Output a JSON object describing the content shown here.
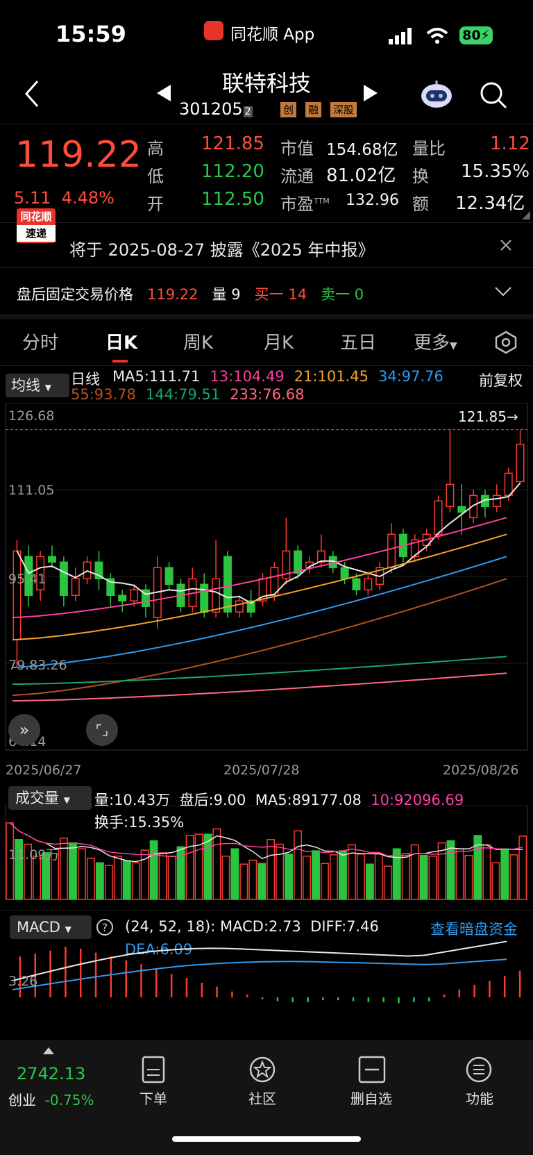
{
  "status": {
    "time": "15:59",
    "app": "同花顺 App",
    "battery": "80"
  },
  "header": {
    "title": "联特科技",
    "code": "301205",
    "code_suffix": "2",
    "tags": [
      "创",
      "融",
      "深股"
    ]
  },
  "quote": {
    "price": "119.22",
    "change": "5.11",
    "change_pct": "4.48%",
    "high_label": "高",
    "high": "121.85",
    "low_label": "低",
    "low": "112.20",
    "open_label": "开",
    "open": "112.50",
    "mcap_label": "市值",
    "mcap": "154.68亿",
    "float_label": "流通",
    "float": "81.02亿",
    "pe_label": "市盈",
    "pe_sup": "TTM",
    "pe": "132.96",
    "vol_ratio_label": "量比",
    "vol_ratio": "1.12",
    "turnover_label": "换",
    "turnover": "15.35%",
    "amount_label": "额",
    "amount": "12.34亿"
  },
  "notice": {
    "logo_top": "同花顺",
    "logo_bottom": "速递",
    "text": "将于 2025-08-27 披露《2025 年中报》"
  },
  "after_hours": {
    "label": "盘后固定交易价格",
    "price": "119.22",
    "vol_label": "量",
    "vol": "9",
    "buy_label": "买一",
    "buy": "14",
    "sell_label": "卖一",
    "sell": "0"
  },
  "tabs": [
    "分时",
    "日K",
    "周K",
    "月K",
    "五日",
    "更多"
  ],
  "kline": {
    "indicator_btn": "均线",
    "line_label": "日线",
    "ma": [
      {
        "label": "MA5:111.71",
        "color": "#e8e8e8"
      },
      {
        "label": "13:104.49",
        "color": "#ff3fa0"
      },
      {
        "label": "21:101.45",
        "color": "#f4a326"
      },
      {
        "label": "34:97.76",
        "color": "#2e9bf0"
      },
      {
        "label": "55:93.78",
        "color": "#b5521f"
      },
      {
        "label": "144:79.51",
        "color": "#1aa66b"
      },
      {
        "label": "233:76.68",
        "color": "#ff6a82"
      }
    ],
    "adjust": "前复权",
    "y_ticks": [
      "126.68",
      "111.05",
      "95.41",
      "79.83.26",
      "64.14"
    ],
    "high_marker": "121.85→",
    "dates": [
      "2025/06/27",
      "2025/07/28",
      "2025/08/26"
    ]
  },
  "volume": {
    "btn": "成交量",
    "vol": "量:10.43万",
    "after": "盘后:9.00",
    "ma5": "MA5:89177.08",
    "ma10": "10:92096.69",
    "turnover": "换手:15.35%",
    "y_tick": "11.09万"
  },
  "macd": {
    "btn": "MACD",
    "params": "(24, 52, 18):",
    "macd": "MACD:2.73",
    "diff": "DIFF:7.46",
    "dea": "DEA:6.09",
    "y_tick": "3.26",
    "link": "查看暗盘资金"
  },
  "dock": {
    "index_value": "2742.13",
    "index_name": "创业",
    "index_chg": "-0.75%",
    "items": [
      "下单",
      "社区",
      "删自选",
      "功能"
    ]
  },
  "chart_data": {
    "type": "candlestick",
    "ylim": [
      64.14,
      126.68
    ],
    "candles": [
      {
        "o": 84,
        "c": 100,
        "h": 102,
        "l": 79
      },
      {
        "o": 99,
        "c": 92,
        "h": 101,
        "l": 90
      },
      {
        "o": 93,
        "c": 99,
        "h": 100,
        "l": 91
      },
      {
        "o": 99,
        "c": 98,
        "h": 101,
        "l": 97
      },
      {
        "o": 98,
        "c": 92,
        "h": 99,
        "l": 90
      },
      {
        "o": 92,
        "c": 95,
        "h": 97,
        "l": 91
      },
      {
        "o": 95,
        "c": 98,
        "h": 99,
        "l": 94
      },
      {
        "o": 98,
        "c": 95,
        "h": 100,
        "l": 93
      },
      {
        "o": 95,
        "c": 92,
        "h": 96,
        "l": 90
      },
      {
        "o": 92,
        "c": 91,
        "h": 93,
        "l": 89
      },
      {
        "o": 91,
        "c": 93,
        "h": 94,
        "l": 90
      },
      {
        "o": 93,
        "c": 90,
        "h": 94,
        "l": 88
      },
      {
        "o": 88,
        "c": 97,
        "h": 99,
        "l": 86
      },
      {
        "o": 97,
        "c": 94,
        "h": 98,
        "l": 93
      },
      {
        "o": 94,
        "c": 90,
        "h": 95,
        "l": 89
      },
      {
        "o": 90,
        "c": 95,
        "h": 97,
        "l": 89
      },
      {
        "o": 94,
        "c": 89,
        "h": 96,
        "l": 88
      },
      {
        "o": 89,
        "c": 95,
        "h": 102,
        "l": 88
      },
      {
        "o": 99,
        "c": 89,
        "h": 100,
        "l": 88
      },
      {
        "o": 89,
        "c": 91,
        "h": 92,
        "l": 88
      },
      {
        "o": 91,
        "c": 89,
        "h": 93,
        "l": 88
      },
      {
        "o": 91,
        "c": 95,
        "h": 96,
        "l": 90
      },
      {
        "o": 92,
        "c": 97,
        "h": 98,
        "l": 91
      },
      {
        "o": 95,
        "c": 100,
        "h": 106,
        "l": 94
      },
      {
        "o": 100,
        "c": 96,
        "h": 101,
        "l": 95
      },
      {
        "o": 97,
        "c": 98,
        "h": 99,
        "l": 96
      },
      {
        "o": 98,
        "c": 100,
        "h": 103,
        "l": 97
      },
      {
        "o": 99,
        "c": 97,
        "h": 100,
        "l": 96
      },
      {
        "o": 97,
        "c": 95,
        "h": 98,
        "l": 94
      },
      {
        "o": 95,
        "c": 93,
        "h": 96,
        "l": 92
      },
      {
        "o": 93,
        "c": 95,
        "h": 96,
        "l": 92
      },
      {
        "o": 94,
        "c": 97,
        "h": 98,
        "l": 93
      },
      {
        "o": 97,
        "c": 103,
        "h": 105,
        "l": 96
      },
      {
        "o": 103,
        "c": 99,
        "h": 104,
        "l": 98
      },
      {
        "o": 99,
        "c": 102,
        "h": 103,
        "l": 98
      },
      {
        "o": 101,
        "c": 103,
        "h": 104,
        "l": 100
      },
      {
        "o": 103,
        "c": 109,
        "h": 110,
        "l": 102
      },
      {
        "o": 108,
        "c": 112,
        "h": 122,
        "l": 107
      },
      {
        "o": 108,
        "c": 107,
        "h": 112,
        "l": 103
      },
      {
        "o": 106,
        "c": 110,
        "h": 111,
        "l": 105
      },
      {
        "o": 110,
        "c": 108,
        "h": 111,
        "l": 106
      },
      {
        "o": 108,
        "c": 110,
        "h": 112,
        "l": 107
      },
      {
        "o": 110,
        "c": 114,
        "h": 115,
        "l": 109
      },
      {
        "o": 112.5,
        "c": 119.22,
        "h": 121.85,
        "l": 112.2
      }
    ],
    "volume_max": 12,
    "volume": [
      11.5,
      9,
      8.3,
      6.5,
      7,
      7.5,
      9.2,
      8.5,
      7.6,
      6.2,
      5.5,
      5.1,
      6.5,
      5.8,
      5.5,
      7.4,
      8.8,
      7,
      6.5,
      7.9,
      9.6,
      9.8,
      9.8,
      10.6,
      6.5,
      7.6,
      5.3,
      5.9,
      5.4,
      9,
      8.3,
      6.8,
      10.3,
      6.5,
      7.3,
      5.4,
      6.7,
      7.3,
      8.2,
      6.8,
      5.3,
      6.8,
      5,
      7.6,
      6.9,
      8.2,
      6.6,
      6.5,
      8.5,
      8.8,
      7.6,
      6.6,
      9.6,
      8.2,
      5.5,
      7.6,
      6.7,
      9.5
    ],
    "volume_colors": "mixed",
    "macd_hist": [
      4.2,
      4.5,
      4.8,
      5.2,
      5.0,
      4.6,
      4.2,
      3.8,
      3.4,
      3.0,
      2.4,
      2.0,
      1.5,
      1.1,
      0.6,
      0.3,
      -0.2,
      -0.4,
      -0.5,
      -0.5,
      -0.3,
      -0.3,
      -0.4,
      -0.5,
      -0.5,
      -0.6,
      -0.5,
      -0.4,
      0.3,
      0.8,
      1.3,
      1.7,
      2.2,
      2.73
    ]
  }
}
